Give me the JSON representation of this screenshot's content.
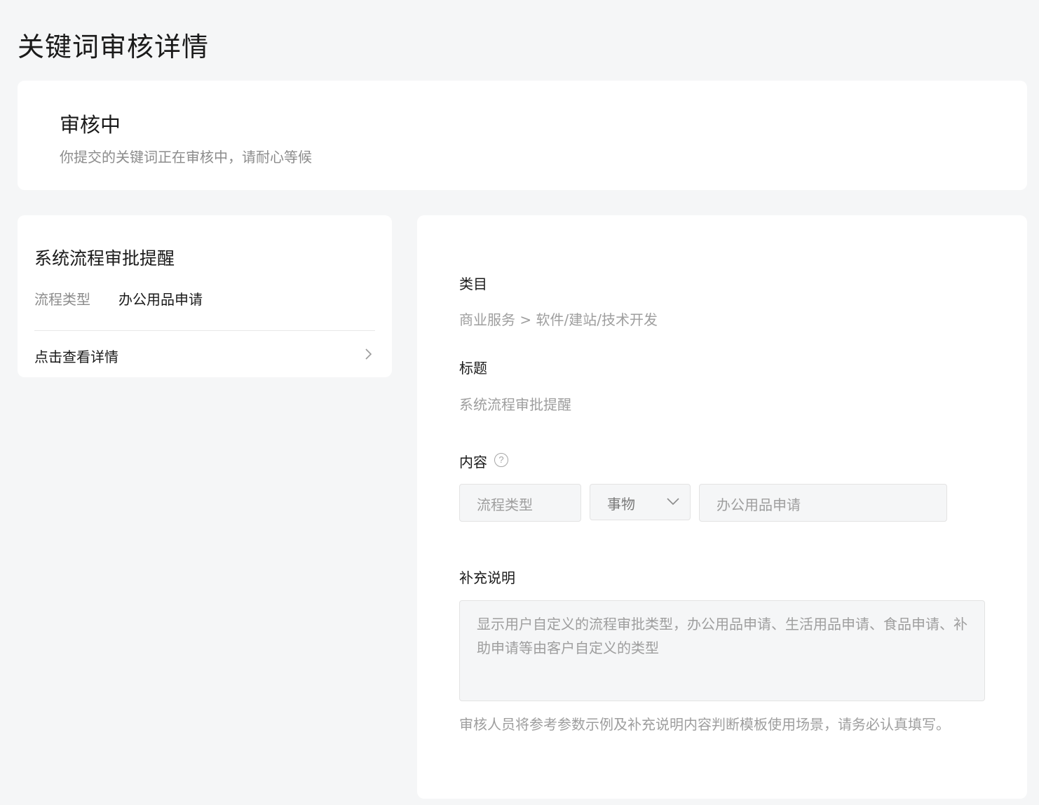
{
  "page_title": "关键词审核详情",
  "status": {
    "title": "审核中",
    "description": "你提交的关键词正在审核中，请耐心等候"
  },
  "summary": {
    "title": "系统流程审批提醒",
    "type_label": "流程类型",
    "type_value": "办公用品申请",
    "detail_link": "点击查看详情"
  },
  "form": {
    "category_label": "类目",
    "category_value": "商业服务 > 软件/建站/技术开发",
    "title_label": "标题",
    "title_value": "系统流程审批提醒",
    "content_label": "内容",
    "help_glyph": "?",
    "param_name": "流程类型",
    "param_type_selected": "事物",
    "param_example": "办公用品申请",
    "note_label": "补充说明",
    "note_value": "显示用户自定义的流程审批类型，办公用品申请、生活用品申请、食品申请、补助申请等由客户自定义的类型",
    "hint": "审核人员将参考参数示例及补充说明内容判断模板使用场景，请务必认真填写。"
  }
}
